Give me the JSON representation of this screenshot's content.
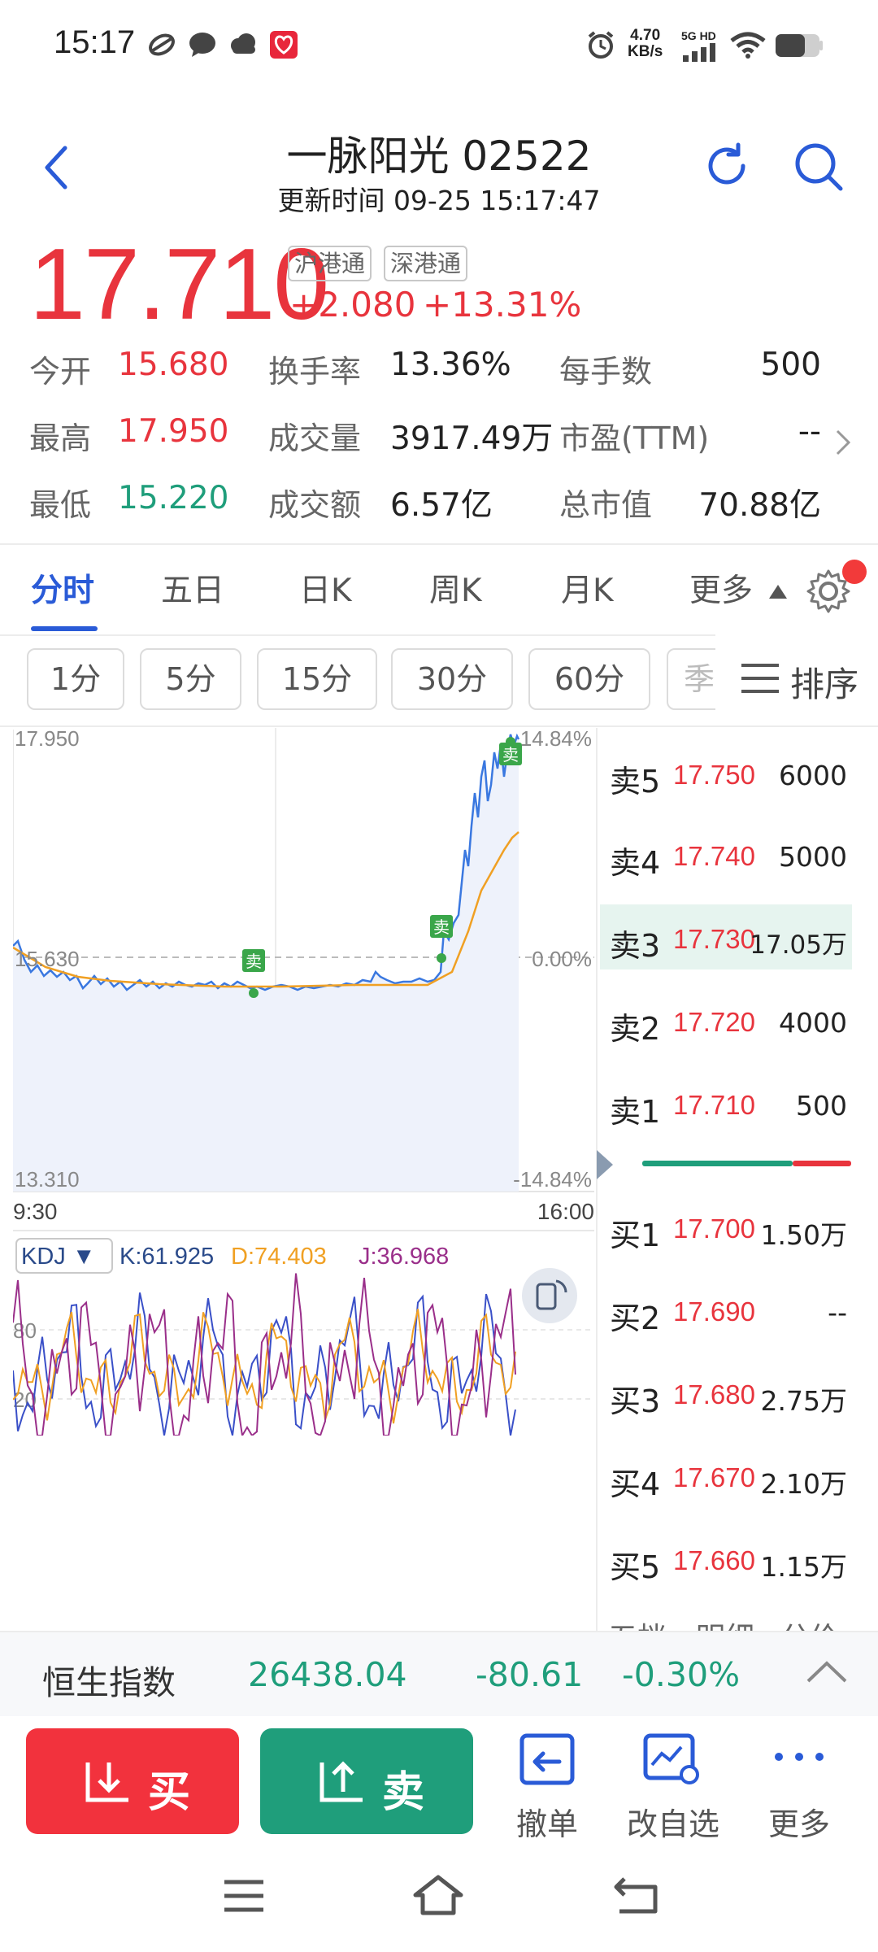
{
  "status_bar": {
    "time": "15:17",
    "net_speed_value": "4.70",
    "net_speed_unit": "KB/s",
    "signal_text": "5G HD"
  },
  "header": {
    "title": "一脉阳光 02522",
    "subtitle": "更新时间 09-25 15:17:47"
  },
  "quote": {
    "price": "17.710",
    "tags": [
      "沪港通",
      "深港通"
    ],
    "change": "+2.080",
    "change_pct": "+13.31%"
  },
  "stats": [
    {
      "label": "今开",
      "value": "15.680",
      "color": "red"
    },
    {
      "label": "换手率",
      "value": "13.36%",
      "color": "black"
    },
    {
      "label": "每手数",
      "value": "500",
      "color": "black"
    },
    {
      "label": "最高",
      "value": "17.950",
      "color": "red"
    },
    {
      "label": "成交量",
      "value": "3917.49万",
      "color": "black"
    },
    {
      "label": "市盈(TTM)",
      "value": "--",
      "color": "black"
    },
    {
      "label": "最低",
      "value": "15.220",
      "color": "green"
    },
    {
      "label": "成交额",
      "value": "6.57亿",
      "color": "black"
    },
    {
      "label": "总市值",
      "value": "70.88亿",
      "color": "black"
    }
  ],
  "period_tabs": [
    "分时",
    "五日",
    "日K",
    "周K",
    "月K",
    "更多"
  ],
  "active_period_tab": "分时",
  "interval_chips": [
    "1分",
    "5分",
    "15分",
    "30分",
    "60分",
    "季"
  ],
  "sort_label": "排序",
  "chart": {
    "y_high": "17.950",
    "y_mid": "15.630",
    "y_low": "13.310",
    "pct_high": "14.84%",
    "pct_mid": "0.00%",
    "pct_low": "-14.84%",
    "x_start": "9:30",
    "x_end": "16:00",
    "sell_marker": "卖",
    "price_line_color": "#3a78e0",
    "avg_line_color": "#f0a023"
  },
  "kdj": {
    "selector": "KDJ ▼",
    "k": "K:61.925",
    "d": "D:74.403",
    "j": "J:36.968",
    "tick_80": "80",
    "tick_20": "20"
  },
  "order_book": {
    "asks": [
      {
        "label": "卖5",
        "price": "17.750",
        "volume": "6000"
      },
      {
        "label": "卖4",
        "price": "17.740",
        "volume": "5000"
      },
      {
        "label": "卖3",
        "price": "17.730",
        "volume": "17.05万"
      },
      {
        "label": "卖2",
        "price": "17.720",
        "volume": "4000"
      },
      {
        "label": "卖1",
        "price": "17.710",
        "volume": "500"
      }
    ],
    "bids": [
      {
        "label": "买1",
        "price": "17.700",
        "volume": "1.50万"
      },
      {
        "label": "买2",
        "price": "17.690",
        "volume": "--"
      },
      {
        "label": "买3",
        "price": "17.680",
        "volume": "2.75万"
      },
      {
        "label": "买4",
        "price": "17.670",
        "volume": "2.10万"
      },
      {
        "label": "买5",
        "price": "17.660",
        "volume": "1.15万"
      }
    ],
    "bottom_tabs": [
      "五档",
      "明细",
      "分价"
    ]
  },
  "index_bar": {
    "name": "恒生指数",
    "value": "26438.04",
    "change": "-80.61",
    "change_pct": "-0.30%"
  },
  "actions": {
    "buy": "买",
    "sell": "卖",
    "cancel": "撤单",
    "watchlist": "改自选",
    "more": "更多"
  }
}
